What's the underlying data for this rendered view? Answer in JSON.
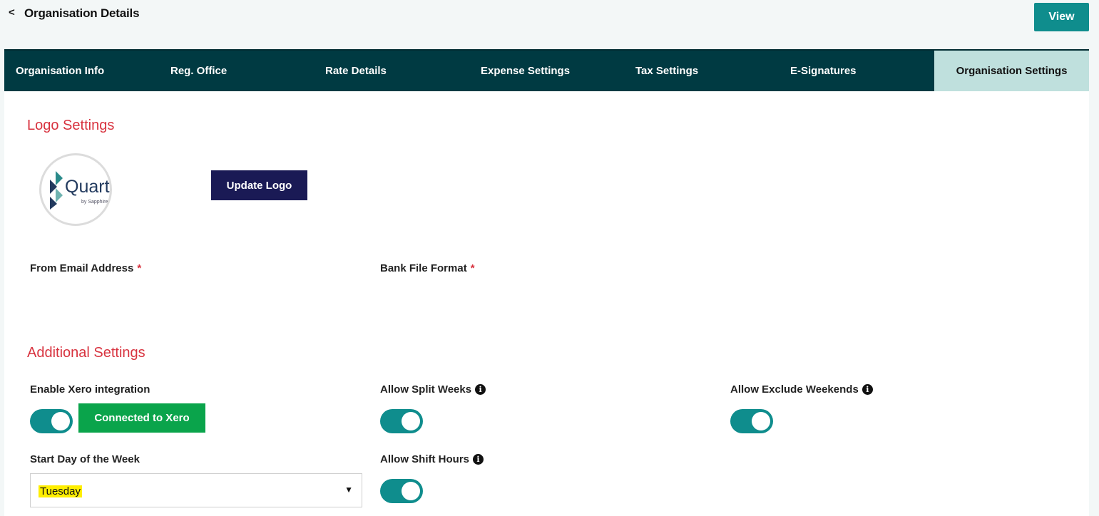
{
  "header": {
    "back_icon": "<",
    "title": "Organisation Details",
    "view_label": "View"
  },
  "tabs": [
    {
      "label": "Organisation Info"
    },
    {
      "label": "Reg. Office"
    },
    {
      "label": "Rate Details"
    },
    {
      "label": "Expense Settings"
    },
    {
      "label": "Tax Settings"
    },
    {
      "label": "E-Signatures"
    },
    {
      "label": "Organisation Settings",
      "active": true
    }
  ],
  "logo_settings": {
    "title": "Logo Settings",
    "logo_text": "Quartz",
    "logo_sub": "by Sapphire",
    "update_label": "Update Logo"
  },
  "fields": {
    "from_email_label": "From Email Address",
    "bank_file_label": "Bank File Format",
    "required_mark": "*"
  },
  "additional_settings": {
    "title": "Additional Settings",
    "xero_label": "Enable Xero integration",
    "xero_connected_label": "Connected to Xero",
    "xero_enabled": true,
    "split_weeks_label": "Allow Split Weeks",
    "split_weeks_enabled": true,
    "exclude_weekends_label": "Allow Exclude Weekends",
    "exclude_weekends_enabled": true,
    "start_day_label": "Start Day of the Week",
    "start_day_value": "Tuesday",
    "shift_hours_label": "Allow Shift Hours",
    "shift_hours_enabled": true,
    "info_icon": "i"
  },
  "colors": {
    "accent": "#0f8d8d",
    "tab_bar": "#003a42",
    "active_tab": "#bfe0dd",
    "section_title": "#d8333f",
    "xero_green": "#0aa44b",
    "update_button": "#1a1a55"
  }
}
